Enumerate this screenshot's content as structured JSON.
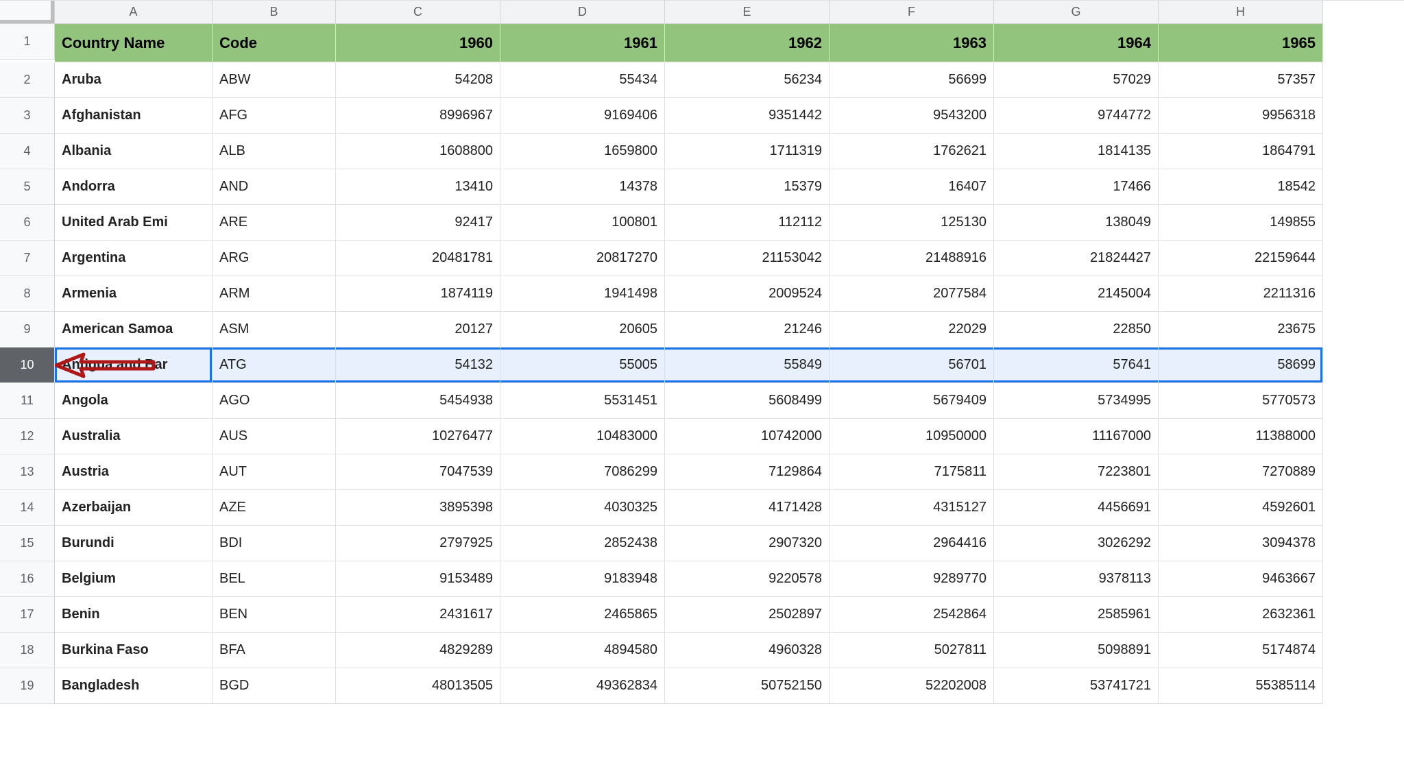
{
  "columns": [
    "A",
    "B",
    "C",
    "D",
    "E",
    "F",
    "G",
    "H"
  ],
  "header_row": [
    "Country Name",
    "Code",
    "1960",
    "1961",
    "1962",
    "1963",
    "1964",
    "1965"
  ],
  "selected_row_index": 8,
  "rows": [
    {
      "n": 2,
      "name": "Aruba",
      "code": "ABW",
      "v": [
        "54208",
        "55434",
        "56234",
        "56699",
        "57029",
        "57357"
      ]
    },
    {
      "n": 3,
      "name": "Afghanistan",
      "code": "AFG",
      "v": [
        "8996967",
        "9169406",
        "9351442",
        "9543200",
        "9744772",
        "9956318"
      ]
    },
    {
      "n": 4,
      "name": "Albania",
      "code": "ALB",
      "v": [
        "1608800",
        "1659800",
        "1711319",
        "1762621",
        "1814135",
        "1864791"
      ]
    },
    {
      "n": 5,
      "name": "Andorra",
      "code": "AND",
      "v": [
        "13410",
        "14378",
        "15379",
        "16407",
        "17466",
        "18542"
      ]
    },
    {
      "n": 6,
      "name": "United Arab Emi",
      "code": "ARE",
      "v": [
        "92417",
        "100801",
        "112112",
        "125130",
        "138049",
        "149855"
      ]
    },
    {
      "n": 7,
      "name": "Argentina",
      "code": "ARG",
      "v": [
        "20481781",
        "20817270",
        "21153042",
        "21488916",
        "21824427",
        "22159644"
      ]
    },
    {
      "n": 8,
      "name": "Armenia",
      "code": "ARM",
      "v": [
        "1874119",
        "1941498",
        "2009524",
        "2077584",
        "2145004",
        "2211316"
      ]
    },
    {
      "n": 9,
      "name": "American Samoa",
      "code": "ASM",
      "v": [
        "20127",
        "20605",
        "21246",
        "22029",
        "22850",
        "23675"
      ]
    },
    {
      "n": 10,
      "name": "Antigua and Bar",
      "code": "ATG",
      "v": [
        "54132",
        "55005",
        "55849",
        "56701",
        "57641",
        "58699"
      ]
    },
    {
      "n": 11,
      "name": "Angola",
      "code": "AGO",
      "v": [
        "5454938",
        "5531451",
        "5608499",
        "5679409",
        "5734995",
        "5770573"
      ]
    },
    {
      "n": 12,
      "name": "Australia",
      "code": "AUS",
      "v": [
        "10276477",
        "10483000",
        "10742000",
        "10950000",
        "11167000",
        "11388000"
      ]
    },
    {
      "n": 13,
      "name": "Austria",
      "code": "AUT",
      "v": [
        "7047539",
        "7086299",
        "7129864",
        "7175811",
        "7223801",
        "7270889"
      ]
    },
    {
      "n": 14,
      "name": "Azerbaijan",
      "code": "AZE",
      "v": [
        "3895398",
        "4030325",
        "4171428",
        "4315127",
        "4456691",
        "4592601"
      ]
    },
    {
      "n": 15,
      "name": "Burundi",
      "code": "BDI",
      "v": [
        "2797925",
        "2852438",
        "2907320",
        "2964416",
        "3026292",
        "3094378"
      ]
    },
    {
      "n": 16,
      "name": "Belgium",
      "code": "BEL",
      "v": [
        "9153489",
        "9183948",
        "9220578",
        "9289770",
        "9378113",
        "9463667"
      ]
    },
    {
      "n": 17,
      "name": "Benin",
      "code": "BEN",
      "v": [
        "2431617",
        "2465865",
        "2502897",
        "2542864",
        "2585961",
        "2632361"
      ]
    },
    {
      "n": 18,
      "name": "Burkina Faso",
      "code": "BFA",
      "v": [
        "4829289",
        "4894580",
        "4960328",
        "5027811",
        "5098891",
        "5174874"
      ]
    },
    {
      "n": 19,
      "name": "Bangladesh",
      "code": "BGD",
      "v": [
        "48013505",
        "49362834",
        "50752150",
        "52202008",
        "53741721",
        "55385114"
      ]
    }
  ],
  "annotation": {
    "arrow_points": "left"
  }
}
